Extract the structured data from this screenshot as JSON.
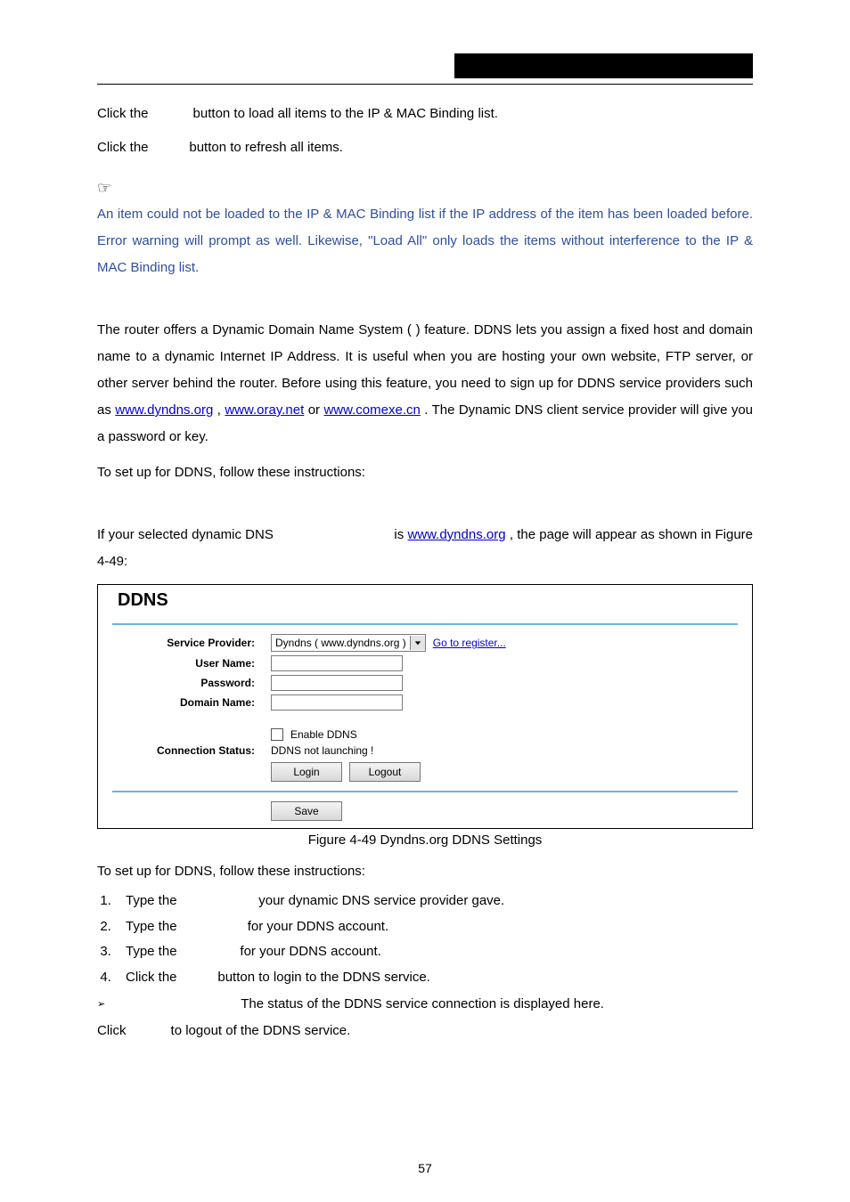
{
  "header": {
    "click_line_1_a": "Click the ",
    "click_line_1_b": " button to load all items to the IP & MAC Binding list.",
    "click_line_2_a": "Click the ",
    "click_line_2_b": " button to refresh all items."
  },
  "note": {
    "text": "An item could not be loaded to the IP & MAC Binding list if the IP address of the item has been loaded before. Error warning will prompt as well. Likewise, \"Load All\" only loads the items without interference to the IP & MAC Binding list."
  },
  "ddns_intro": {
    "p1_a": "The router offers a Dynamic Domain Name System (        ) feature. DDNS lets you assign a fixed host and domain name to a dynamic Internet IP Address. It is useful when you are hosting your own website, FTP server, or other server behind the router. Before using this feature, you need to sign up for DDNS service providers such as ",
    "link1": "www.dyndns.org",
    "p1_b": ", ",
    "link2": "www.oray.net",
    "p1_c": " or ",
    "link3": "www.comexe.cn",
    "p1_d": ". The Dynamic DNS client service provider will give you a password or key.",
    "setup_line": "To set up for DDNS, follow these instructions:"
  },
  "selected_line": {
    "a": "If your selected dynamic DNS ",
    "b": " is ",
    "link": "www.dyndns.org",
    "c": ", the page will appear as shown in Figure 4-49:"
  },
  "figure": {
    "title": "DDNS",
    "labels": {
      "service_provider": "Service Provider:",
      "user_name": "User Name:",
      "password": "Password:",
      "domain_name": "Domain Name:",
      "connection_status": "Connection Status:"
    },
    "service_provider_value": "Dyndns ( www.dyndns.org )",
    "go_to_register": "Go to register...",
    "enable_ddns": "Enable DDNS",
    "conn_status_value": "DDNS not launching !",
    "login_btn": "Login",
    "logout_btn": "Logout",
    "save_btn": "Save",
    "caption": "Figure 4-49    Dyndns.org DDNS Settings"
  },
  "steps_intro": "To set up for DDNS, follow these instructions:",
  "steps": {
    "s1_a": "Type the ",
    "s1_b": " your dynamic DNS service provider gave.",
    "s2_a": "Type the ",
    "s2_b": " for your DDNS account.",
    "s3_a": "Type the ",
    "s3_b": " for your DDNS account.",
    "s4_a": "Click the ",
    "s4_b": " button to login to the DDNS service."
  },
  "bullet": {
    "text": "The status of the DDNS service connection is displayed here."
  },
  "logout_line": {
    "a": "Click ",
    "b": " to logout of the DDNS service."
  },
  "page_number": "57"
}
